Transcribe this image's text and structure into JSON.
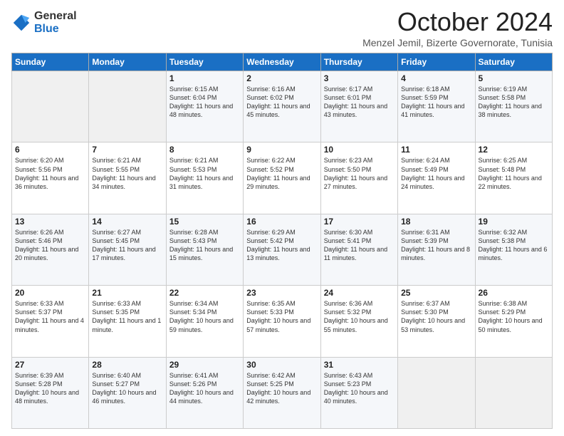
{
  "logo": {
    "general": "General",
    "blue": "Blue"
  },
  "title": "October 2024",
  "subtitle": "Menzel Jemil, Bizerte Governorate, Tunisia",
  "days_of_week": [
    "Sunday",
    "Monday",
    "Tuesday",
    "Wednesday",
    "Thursday",
    "Friday",
    "Saturday"
  ],
  "weeks": [
    [
      {
        "day": "",
        "sunrise": "",
        "sunset": "",
        "daylight": ""
      },
      {
        "day": "",
        "sunrise": "",
        "sunset": "",
        "daylight": ""
      },
      {
        "day": "1",
        "sunrise": "Sunrise: 6:15 AM",
        "sunset": "Sunset: 6:04 PM",
        "daylight": "Daylight: 11 hours and 48 minutes."
      },
      {
        "day": "2",
        "sunrise": "Sunrise: 6:16 AM",
        "sunset": "Sunset: 6:02 PM",
        "daylight": "Daylight: 11 hours and 45 minutes."
      },
      {
        "day": "3",
        "sunrise": "Sunrise: 6:17 AM",
        "sunset": "Sunset: 6:01 PM",
        "daylight": "Daylight: 11 hours and 43 minutes."
      },
      {
        "day": "4",
        "sunrise": "Sunrise: 6:18 AM",
        "sunset": "Sunset: 5:59 PM",
        "daylight": "Daylight: 11 hours and 41 minutes."
      },
      {
        "day": "5",
        "sunrise": "Sunrise: 6:19 AM",
        "sunset": "Sunset: 5:58 PM",
        "daylight": "Daylight: 11 hours and 38 minutes."
      }
    ],
    [
      {
        "day": "6",
        "sunrise": "Sunrise: 6:20 AM",
        "sunset": "Sunset: 5:56 PM",
        "daylight": "Daylight: 11 hours and 36 minutes."
      },
      {
        "day": "7",
        "sunrise": "Sunrise: 6:21 AM",
        "sunset": "Sunset: 5:55 PM",
        "daylight": "Daylight: 11 hours and 34 minutes."
      },
      {
        "day": "8",
        "sunrise": "Sunrise: 6:21 AM",
        "sunset": "Sunset: 5:53 PM",
        "daylight": "Daylight: 11 hours and 31 minutes."
      },
      {
        "day": "9",
        "sunrise": "Sunrise: 6:22 AM",
        "sunset": "Sunset: 5:52 PM",
        "daylight": "Daylight: 11 hours and 29 minutes."
      },
      {
        "day": "10",
        "sunrise": "Sunrise: 6:23 AM",
        "sunset": "Sunset: 5:50 PM",
        "daylight": "Daylight: 11 hours and 27 minutes."
      },
      {
        "day": "11",
        "sunrise": "Sunrise: 6:24 AM",
        "sunset": "Sunset: 5:49 PM",
        "daylight": "Daylight: 11 hours and 24 minutes."
      },
      {
        "day": "12",
        "sunrise": "Sunrise: 6:25 AM",
        "sunset": "Sunset: 5:48 PM",
        "daylight": "Daylight: 11 hours and 22 minutes."
      }
    ],
    [
      {
        "day": "13",
        "sunrise": "Sunrise: 6:26 AM",
        "sunset": "Sunset: 5:46 PM",
        "daylight": "Daylight: 11 hours and 20 minutes."
      },
      {
        "day": "14",
        "sunrise": "Sunrise: 6:27 AM",
        "sunset": "Sunset: 5:45 PM",
        "daylight": "Daylight: 11 hours and 17 minutes."
      },
      {
        "day": "15",
        "sunrise": "Sunrise: 6:28 AM",
        "sunset": "Sunset: 5:43 PM",
        "daylight": "Daylight: 11 hours and 15 minutes."
      },
      {
        "day": "16",
        "sunrise": "Sunrise: 6:29 AM",
        "sunset": "Sunset: 5:42 PM",
        "daylight": "Daylight: 11 hours and 13 minutes."
      },
      {
        "day": "17",
        "sunrise": "Sunrise: 6:30 AM",
        "sunset": "Sunset: 5:41 PM",
        "daylight": "Daylight: 11 hours and 11 minutes."
      },
      {
        "day": "18",
        "sunrise": "Sunrise: 6:31 AM",
        "sunset": "Sunset: 5:39 PM",
        "daylight": "Daylight: 11 hours and 8 minutes."
      },
      {
        "day": "19",
        "sunrise": "Sunrise: 6:32 AM",
        "sunset": "Sunset: 5:38 PM",
        "daylight": "Daylight: 11 hours and 6 minutes."
      }
    ],
    [
      {
        "day": "20",
        "sunrise": "Sunrise: 6:33 AM",
        "sunset": "Sunset: 5:37 PM",
        "daylight": "Daylight: 11 hours and 4 minutes."
      },
      {
        "day": "21",
        "sunrise": "Sunrise: 6:33 AM",
        "sunset": "Sunset: 5:35 PM",
        "daylight": "Daylight: 11 hours and 1 minute."
      },
      {
        "day": "22",
        "sunrise": "Sunrise: 6:34 AM",
        "sunset": "Sunset: 5:34 PM",
        "daylight": "Daylight: 10 hours and 59 minutes."
      },
      {
        "day": "23",
        "sunrise": "Sunrise: 6:35 AM",
        "sunset": "Sunset: 5:33 PM",
        "daylight": "Daylight: 10 hours and 57 minutes."
      },
      {
        "day": "24",
        "sunrise": "Sunrise: 6:36 AM",
        "sunset": "Sunset: 5:32 PM",
        "daylight": "Daylight: 10 hours and 55 minutes."
      },
      {
        "day": "25",
        "sunrise": "Sunrise: 6:37 AM",
        "sunset": "Sunset: 5:30 PM",
        "daylight": "Daylight: 10 hours and 53 minutes."
      },
      {
        "day": "26",
        "sunrise": "Sunrise: 6:38 AM",
        "sunset": "Sunset: 5:29 PM",
        "daylight": "Daylight: 10 hours and 50 minutes."
      }
    ],
    [
      {
        "day": "27",
        "sunrise": "Sunrise: 6:39 AM",
        "sunset": "Sunset: 5:28 PM",
        "daylight": "Daylight: 10 hours and 48 minutes."
      },
      {
        "day": "28",
        "sunrise": "Sunrise: 6:40 AM",
        "sunset": "Sunset: 5:27 PM",
        "daylight": "Daylight: 10 hours and 46 minutes."
      },
      {
        "day": "29",
        "sunrise": "Sunrise: 6:41 AM",
        "sunset": "Sunset: 5:26 PM",
        "daylight": "Daylight: 10 hours and 44 minutes."
      },
      {
        "day": "30",
        "sunrise": "Sunrise: 6:42 AM",
        "sunset": "Sunset: 5:25 PM",
        "daylight": "Daylight: 10 hours and 42 minutes."
      },
      {
        "day": "31",
        "sunrise": "Sunrise: 6:43 AM",
        "sunset": "Sunset: 5:23 PM",
        "daylight": "Daylight: 10 hours and 40 minutes."
      },
      {
        "day": "",
        "sunrise": "",
        "sunset": "",
        "daylight": ""
      },
      {
        "day": "",
        "sunrise": "",
        "sunset": "",
        "daylight": ""
      }
    ]
  ]
}
